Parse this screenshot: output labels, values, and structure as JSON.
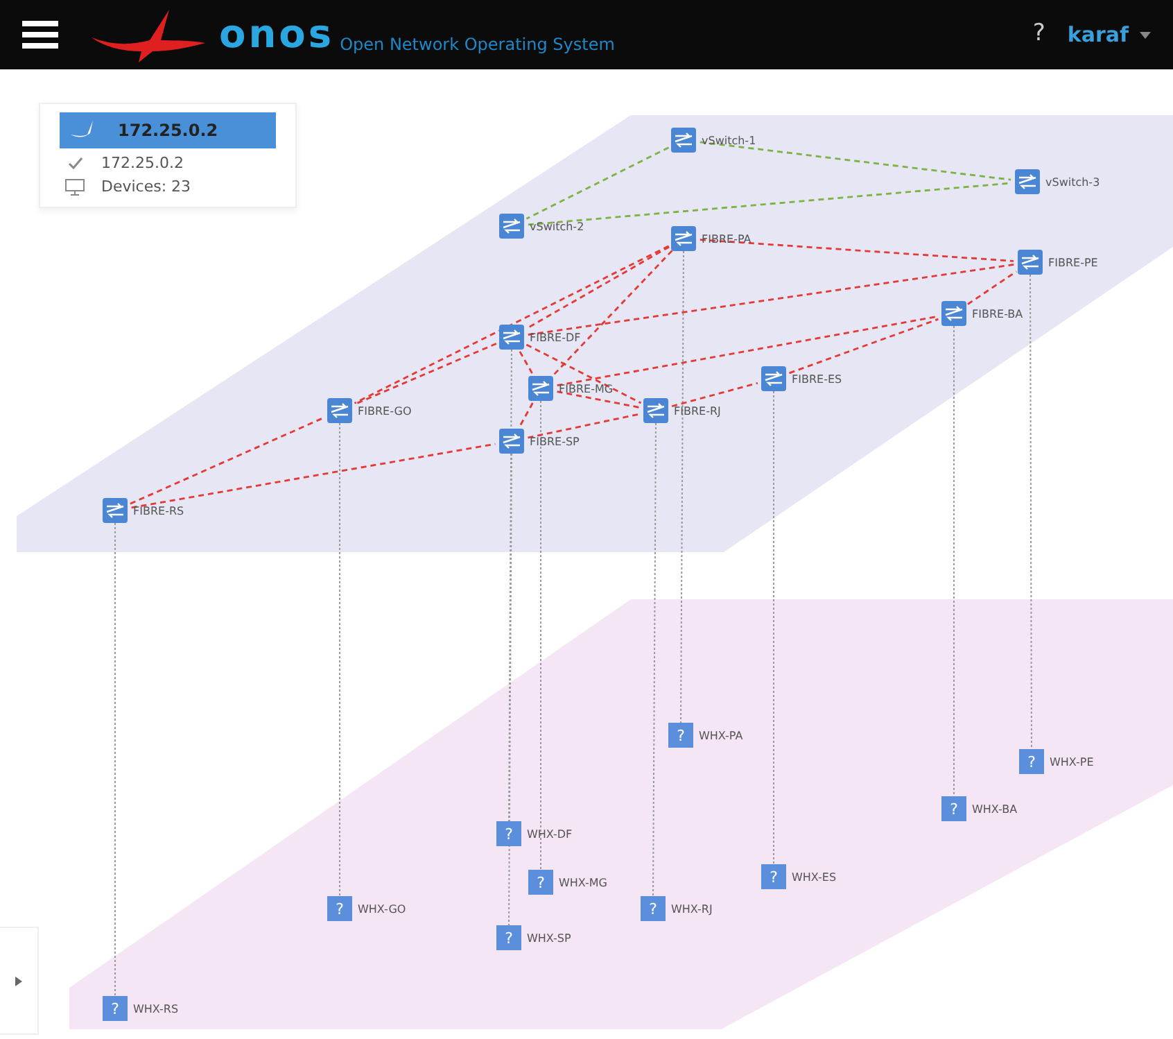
{
  "header": {
    "logo_text": "onos",
    "subtitle": "Open Network Operating System",
    "help": "?",
    "user": "karaf"
  },
  "summary": {
    "title": "172.25.0.2",
    "selected": true,
    "items": [
      {
        "kind": "check",
        "text": "172.25.0.2"
      },
      {
        "kind": "devices",
        "text": "Devices: 23"
      }
    ]
  },
  "switches": [
    {
      "label": "vSwitch-1"
    },
    {
      "label": "vSwitch-2"
    },
    {
      "label": "vSwitch-3"
    },
    {
      "label": "FIBRE-PA"
    },
    {
      "label": "FIBRE-PE"
    },
    {
      "label": "FIBRE-BA"
    },
    {
      "label": "FIBRE-DF"
    },
    {
      "label": "FIBRE-MG"
    },
    {
      "label": "FIBRE-ES"
    },
    {
      "label": "FIBRE-RJ"
    },
    {
      "label": "FIBRE-GO"
    },
    {
      "label": "FIBRE-SP"
    },
    {
      "label": "FIBRE-RS"
    }
  ],
  "hosts": [
    {
      "label": "WHX-PA",
      "glyph": "?"
    },
    {
      "label": "WHX-PE",
      "glyph": "?"
    },
    {
      "label": "WHX-BA",
      "glyph": "?"
    },
    {
      "label": "WHX-DF",
      "glyph": "?"
    },
    {
      "label": "WHX-MG",
      "glyph": "?"
    },
    {
      "label": "WHX-ES",
      "glyph": "?"
    },
    {
      "label": "WHX-GO",
      "glyph": "?"
    },
    {
      "label": "WHX-RJ",
      "glyph": "?"
    },
    {
      "label": "WHX-SP",
      "glyph": "?"
    },
    {
      "label": "WHX-RS",
      "glyph": "?"
    }
  ],
  "links": [
    {
      "color": "#7cb342"
    },
    {
      "color": "#7cb342"
    },
    {
      "color": "#7cb342"
    },
    {
      "color": "#e53935"
    },
    {
      "color": "#e53935"
    },
    {
      "color": "#e53935"
    },
    {
      "color": "#e53935"
    },
    {
      "color": "#e53935"
    },
    {
      "color": "#e53935"
    },
    {
      "color": "#e53935"
    },
    {
      "color": "#e53935"
    },
    {
      "color": "#e53935"
    },
    {
      "color": "#e53935"
    },
    {
      "color": "#e53935"
    },
    {
      "color": "#e53935"
    },
    {
      "color": "#e53935"
    },
    {
      "color": "#e53935"
    },
    {
      "color": "#e53935"
    },
    {
      "color": "#e53935"
    },
    {
      "color": "#e53935"
    }
  ]
}
